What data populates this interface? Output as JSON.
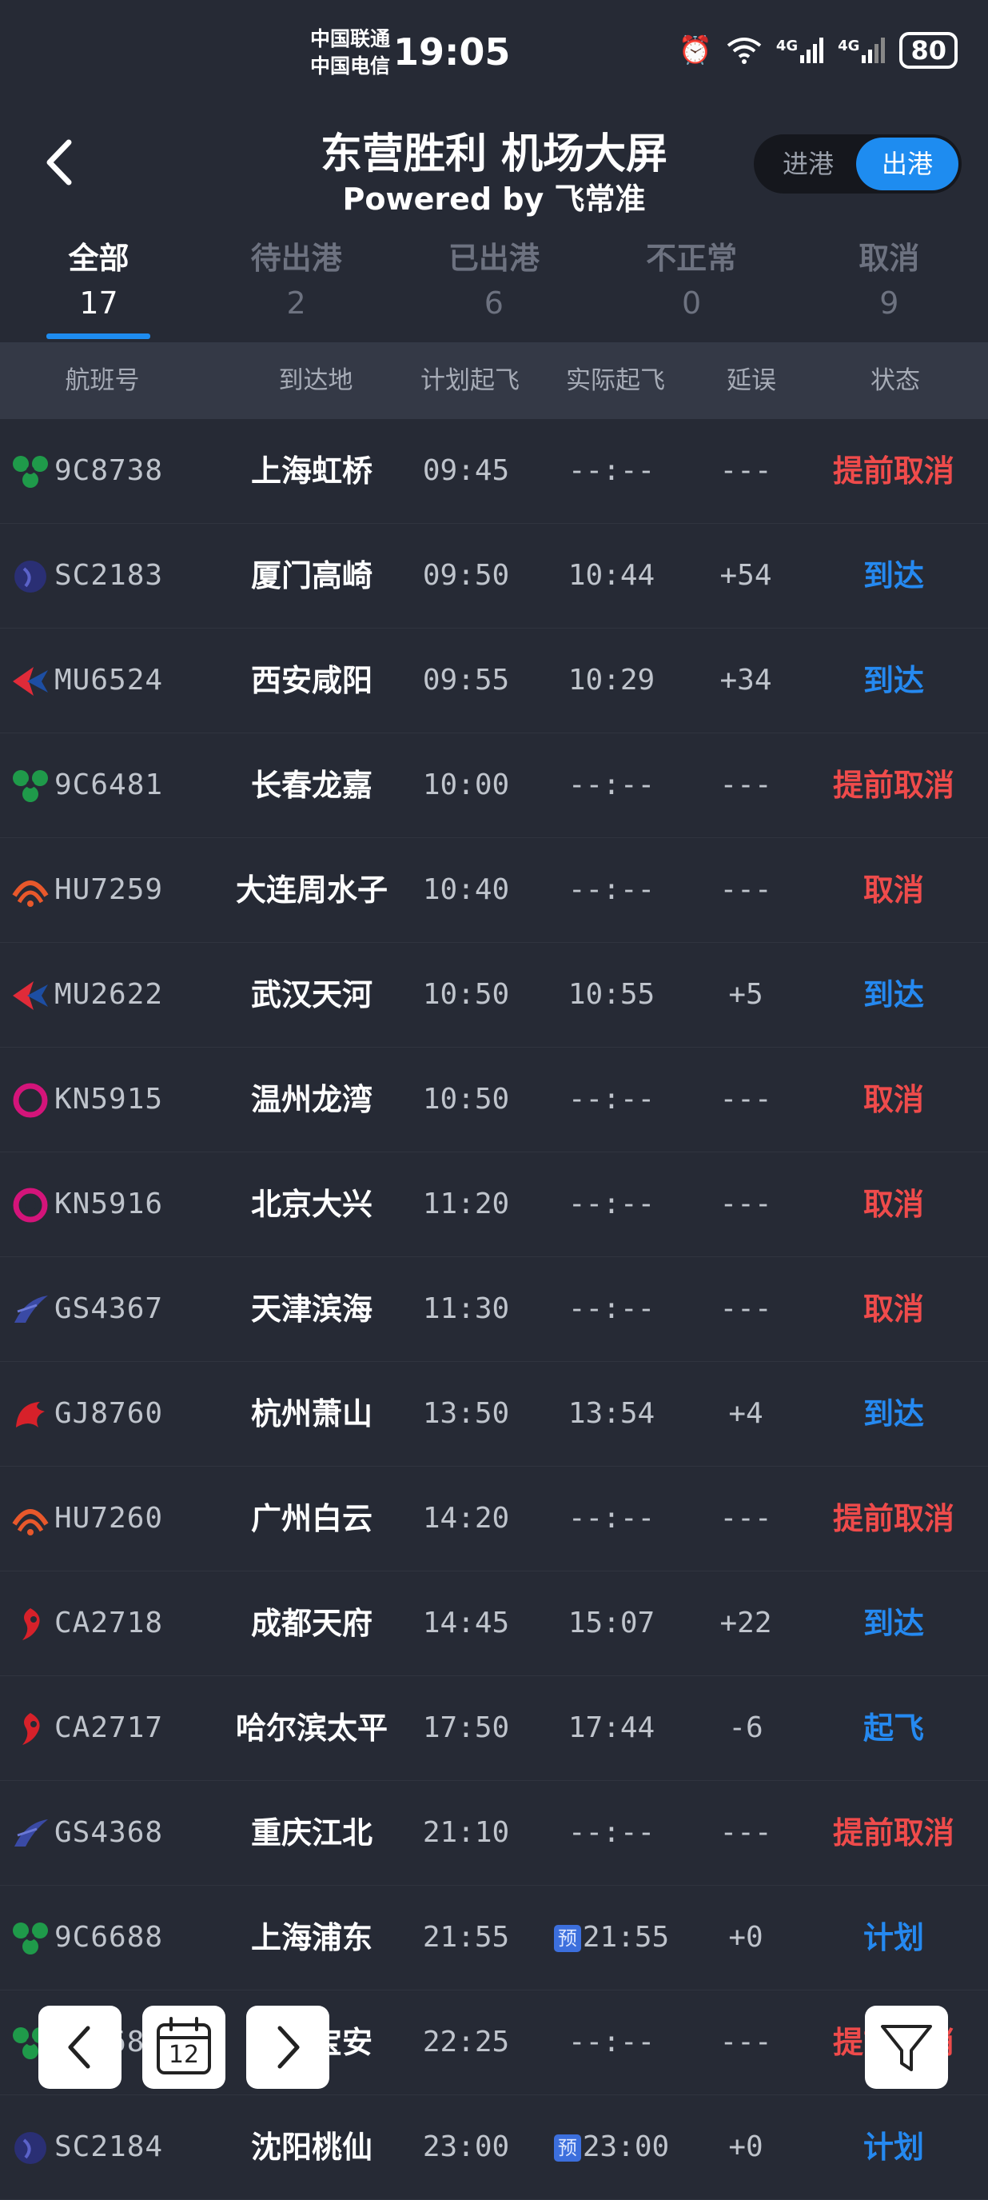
{
  "status_bar": {
    "carrier_1": "中国联通",
    "carrier_2": "中国电信",
    "time": "19:05",
    "net_1": "4G",
    "net_2": "4G",
    "battery": "80"
  },
  "header": {
    "title": "东营胜利 机场大屏",
    "subtitle": "Powered by 飞常准",
    "toggle_in": "进港",
    "toggle_out": "出港",
    "selected_toggle": "出港"
  },
  "tabs": [
    {
      "label": "全部",
      "count": "17",
      "active": true
    },
    {
      "label": "待出港",
      "count": "2",
      "active": false
    },
    {
      "label": "已出港",
      "count": "6",
      "active": false
    },
    {
      "label": "不正常",
      "count": "0",
      "active": false
    },
    {
      "label": "取消",
      "count": "9",
      "active": false
    }
  ],
  "columns": {
    "flight": "航班号",
    "destination": "到达地",
    "scheduled": "计划起飞",
    "actual": "实际起飞",
    "delay": "延误",
    "status": "状态"
  },
  "colors": {
    "cancel_status": "#ef4b4b",
    "normal_status": "#2589f0",
    "accent": "#1e8cf0",
    "background": "#262a35"
  },
  "flights": [
    {
      "airline_icon": "spring-airlines-logo",
      "flight_no": "9C8738",
      "destination": "上海虹桥",
      "scheduled": "09:45",
      "actual": "--:--",
      "delay": "---",
      "status": "提前取消",
      "status_type": "cancel"
    },
    {
      "airline_icon": "shandong-airlines-logo",
      "flight_no": "SC2183",
      "destination": "厦门高崎",
      "scheduled": "09:50",
      "actual": "10:44",
      "delay": "+54",
      "status": "到达",
      "status_type": "normal"
    },
    {
      "airline_icon": "china-eastern-logo",
      "flight_no": "MU6524",
      "destination": "西安咸阳",
      "scheduled": "09:55",
      "actual": "10:29",
      "delay": "+34",
      "status": "到达",
      "status_type": "normal"
    },
    {
      "airline_icon": "spring-airlines-logo",
      "flight_no": "9C6481",
      "destination": "长春龙嘉",
      "scheduled": "10:00",
      "actual": "--:--",
      "delay": "---",
      "status": "提前取消",
      "status_type": "cancel"
    },
    {
      "airline_icon": "hainan-airlines-logo",
      "flight_no": "HU7259",
      "destination": "大连周水子",
      "scheduled": "10:40",
      "actual": "--:--",
      "delay": "---",
      "status": "取消",
      "status_type": "cancel"
    },
    {
      "airline_icon": "china-eastern-logo",
      "flight_no": "MU2622",
      "destination": "武汉天河",
      "scheduled": "10:50",
      "actual": "10:55",
      "delay": "+5",
      "status": "到达",
      "status_type": "normal"
    },
    {
      "airline_icon": "china-united-logo",
      "flight_no": "KN5915",
      "destination": "温州龙湾",
      "scheduled": "10:50",
      "actual": "--:--",
      "delay": "---",
      "status": "取消",
      "status_type": "cancel"
    },
    {
      "airline_icon": "china-united-logo",
      "flight_no": "KN5916",
      "destination": "北京大兴",
      "scheduled": "11:20",
      "actual": "--:--",
      "delay": "---",
      "status": "取消",
      "status_type": "cancel"
    },
    {
      "airline_icon": "grand-china-logo",
      "flight_no": "GS4367",
      "destination": "天津滨海",
      "scheduled": "11:30",
      "actual": "--:--",
      "delay": "---",
      "status": "取消",
      "status_type": "cancel"
    },
    {
      "airline_icon": "loong-air-logo",
      "flight_no": "GJ8760",
      "destination": "杭州萧山",
      "scheduled": "13:50",
      "actual": "13:54",
      "delay": "+4",
      "status": "到达",
      "status_type": "normal"
    },
    {
      "airline_icon": "hainan-airlines-logo",
      "flight_no": "HU7260",
      "destination": "广州白云",
      "scheduled": "14:20",
      "actual": "--:--",
      "delay": "---",
      "status": "提前取消",
      "status_type": "cancel"
    },
    {
      "airline_icon": "air-china-logo",
      "flight_no": "CA2718",
      "destination": "成都天府",
      "scheduled": "14:45",
      "actual": "15:07",
      "delay": "+22",
      "status": "到达",
      "status_type": "normal"
    },
    {
      "airline_icon": "air-china-logo",
      "flight_no": "CA2717",
      "destination": "哈尔滨太平",
      "scheduled": "17:50",
      "actual": "17:44",
      "delay": "-6",
      "status": "起飞",
      "status_type": "normal"
    },
    {
      "airline_icon": "grand-china-logo",
      "flight_no": "GS4368",
      "destination": "重庆江北",
      "scheduled": "21:10",
      "actual": "--:--",
      "delay": "---",
      "status": "提前取消",
      "status_type": "cancel"
    },
    {
      "airline_icon": "spring-airlines-logo",
      "flight_no": "9C6688",
      "destination": "上海浦东",
      "scheduled": "21:55",
      "actual": "21:55",
      "actual_prefix": "预",
      "delay": "+0",
      "status": "计划",
      "status_type": "normal"
    },
    {
      "airline_icon": "spring-airlines-logo",
      "flight_no": "9C6687",
      "destination": "深圳宝安",
      "scheduled": "22:25",
      "actual": "--:--",
      "delay": "---",
      "status": "提前取消",
      "status_type": "cancel"
    },
    {
      "airline_icon": "shandong-airlines-logo",
      "flight_no": "SC2184",
      "destination": "沈阳桃仙",
      "scheduled": "23:00",
      "actual": "23:00",
      "actual_prefix": "预",
      "delay": "+0",
      "status": "计划",
      "status_type": "normal"
    }
  ],
  "bottom_bar": {
    "calendar_day": "12"
  }
}
